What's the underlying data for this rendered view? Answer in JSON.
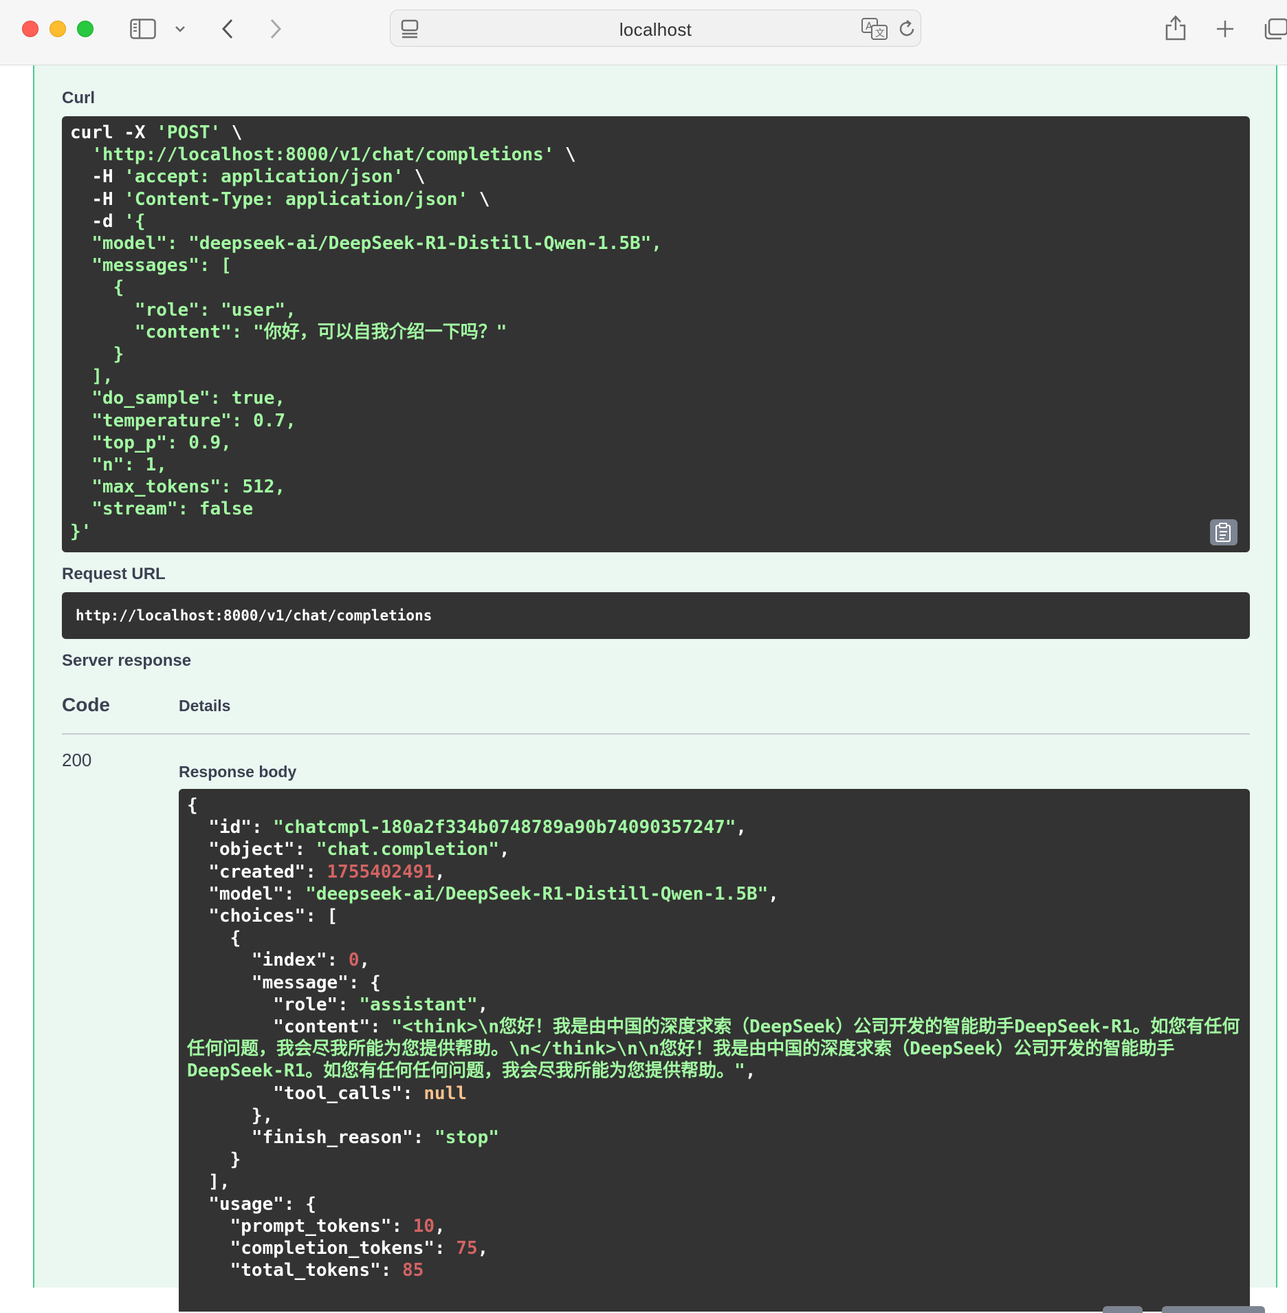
{
  "browser": {
    "url": "localhost",
    "accent_colors": {
      "close": "#ff5f57",
      "minimize": "#febc2e",
      "zoom": "#28c840"
    }
  },
  "sections": {
    "curl_label": "Curl",
    "request_url_label": "Request URL",
    "server_response_label": "Server response",
    "response_body_label": "Response body"
  },
  "request_url": "http://localhost:8000/v1/chat/completions",
  "table": {
    "code_header": "Code",
    "details_header": "Details",
    "status_code": "200"
  },
  "curl": {
    "line1_cmd": "curl -X ",
    "line1_method": "'POST'",
    "line1_end": " \\",
    "line2_url": "'http://localhost:8000/v1/chat/completions'",
    "line3_flag": "-H ",
    "line3_val": "'accept: application/json'",
    "line4_flag": "-H ",
    "line4_val": "'Content-Type: application/json'",
    "cont": " \\",
    "line5_flag": "-d ",
    "line5_val": "'{",
    "body_model": "\"model\": \"deepseek-ai/DeepSeek-R1-Distill-Qwen-1.5B\",",
    "body_messages": "\"messages\": [",
    "brace_open": "{",
    "role_line": "\"role\": \"user\",",
    "content_line": "\"content\": \"你好，可以自我介绍一下吗？\"",
    "brace_close": "}",
    "array_close": "],",
    "do_sample": "\"do_sample\": true,",
    "temperature": "\"temperature\": 0.7,",
    "top_p": "\"top_p\": 0.9,",
    "n": "\"n\": 1,",
    "max_tokens": "\"max_tokens\": 512,",
    "stream": "\"stream\": false",
    "end": "}'"
  },
  "response": {
    "k_id": "\"id\"",
    "v_id": "\"chatcmpl-180a2f334b0748789a90b74090357247\"",
    "k_object": "\"object\"",
    "v_object": "\"chat.completion\"",
    "k_created": "\"created\"",
    "v_created": "1755402491",
    "k_model": "\"model\"",
    "v_model": "\"deepseek-ai/DeepSeek-R1-Distill-Qwen-1.5B\"",
    "k_choices": "\"choices\"",
    "k_index": "\"index\"",
    "v_index": "0",
    "k_message": "\"message\"",
    "k_role": "\"role\"",
    "v_role": "\"assistant\"",
    "k_content": "\"content\"",
    "v_content": "\"<think>\\n您好！我是由中国的深度求索（DeepSeek）公司开发的智能助手DeepSeek-R1。如您有任何任何问题，我会尽我所能为您提供帮助。\\n</think>\\n\\n您好！我是由中国的深度求索（DeepSeek）公司开发的智能助手DeepSeek-R1。如您有任何任何问题，我会尽我所能为您提供帮助。\"",
    "k_tool_calls": "\"tool_calls\"",
    "v_tool_calls": "null",
    "k_finish_reason": "\"finish_reason\"",
    "v_finish_reason": "\"stop\"",
    "k_usage": "\"usage\"",
    "k_prompt_tokens": "\"prompt_tokens\"",
    "v_prompt_tokens": "10",
    "k_completion_tokens": "\"completion_tokens\"",
    "v_completion_tokens": "75",
    "k_total_tokens": "\"total_tokens\"",
    "v_total_tokens": "85"
  }
}
